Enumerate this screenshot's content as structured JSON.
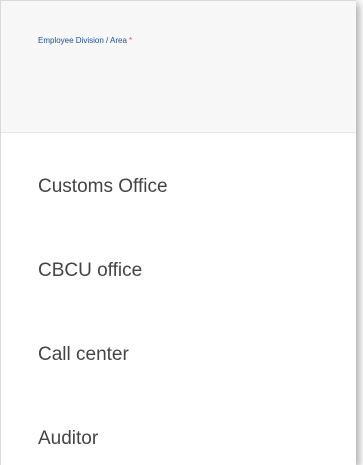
{
  "field": {
    "label": "Employee Division / Area",
    "required_mark": "*",
    "value": ""
  },
  "dropdown": {
    "options": [
      "Customs Office",
      "CBCU office",
      "Call center",
      "Auditor"
    ]
  },
  "colors": {
    "label": "#1d4f91",
    "required": "#d9534f",
    "option_text": "#444444",
    "header_bg": "#f7f7f7"
  }
}
